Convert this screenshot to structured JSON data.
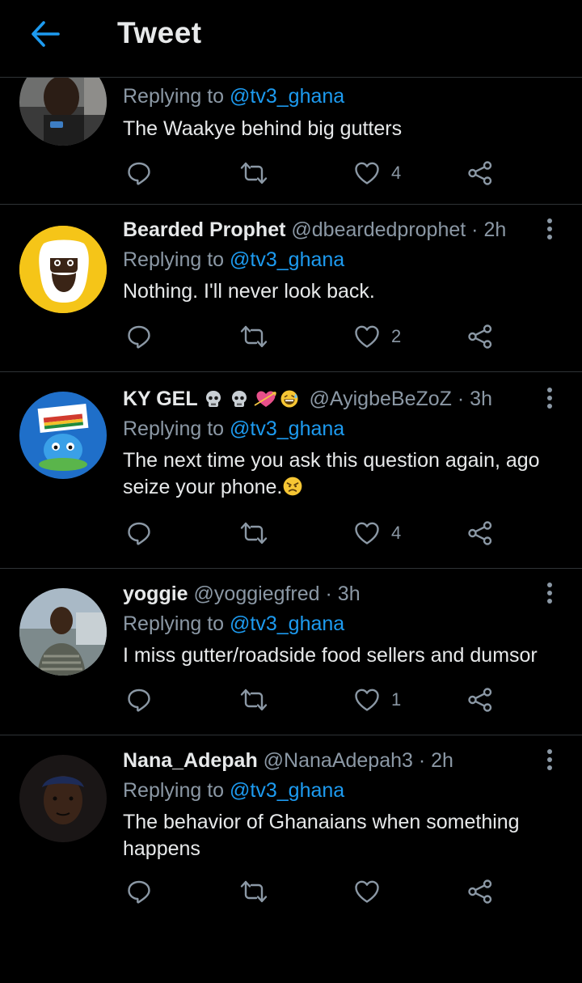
{
  "header": {
    "title": "Tweet",
    "back_icon": "back-arrow-icon",
    "accent": "#1d9bf0"
  },
  "colors": {
    "background": "#000000",
    "primary_text": "#e7e9ea",
    "secondary_text": "#8b98a5",
    "link": "#1d9bf0",
    "divider": "#2f3336"
  },
  "tweets": [
    {
      "name": "",
      "handle": "",
      "time": "",
      "replying_label": "Replying to",
      "replying_to": "@tv3_ghana",
      "text": "The Waakye behind big gutters",
      "likes": "4"
    },
    {
      "name": "Bearded Prophet",
      "handle": "@dbeardedprophet",
      "time": "· 2h",
      "replying_label": "Replying to",
      "replying_to": "@tv3_ghana",
      "text": "Nothing. I'll never look back.",
      "likes": "2"
    },
    {
      "name": "KY GEL",
      "name_emojis": [
        "skull",
        "skull",
        "heart-arrow",
        "grinning-sweat"
      ],
      "handle": "@AyigbeBeZoZ",
      "time": "· 3h",
      "replying_label": "Replying to",
      "replying_to": "@tv3_ghana",
      "text": "The next time you ask this question again, ago seize your phone.",
      "text_emoji": "angry-face",
      "likes": "4"
    },
    {
      "name": "yoggie",
      "handle": "@yoggiegfred",
      "time": "· 3h",
      "replying_label": "Replying to",
      "replying_to": "@tv3_ghana",
      "text": "I miss gutter/roadside food sellers and dumsor",
      "likes": "1"
    },
    {
      "name": "Nana_Adepah",
      "handle": "@NanaAdepah3",
      "time": "· 2h",
      "replying_label": "Replying to",
      "replying_to": "@tv3_ghana",
      "text": "The behavior of Ghanaians when something happens",
      "likes": ""
    }
  ],
  "action_icons": [
    "reply-icon",
    "retweet-icon",
    "like-icon",
    "share-icon"
  ]
}
